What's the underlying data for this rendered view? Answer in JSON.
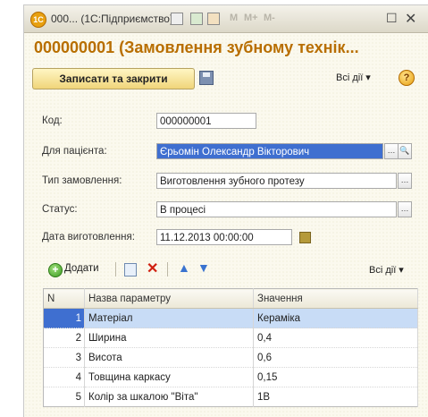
{
  "window": {
    "title": "000... (1С:Підприємство)",
    "toolbar_ghost_labels": [
      "M",
      "M+",
      "M-"
    ]
  },
  "document": {
    "title": "000000001 (Замовлення зубному технік..."
  },
  "command_bar": {
    "save_close_label": "Записати та закрити",
    "all_actions_label": "Всі дії ▾",
    "help_label": "?"
  },
  "form": {
    "code": {
      "label": "Код:",
      "value": "000000001"
    },
    "patient": {
      "label": "Для пацієнта:",
      "value": "Єрьомін Олександр Вікторович"
    },
    "order_type": {
      "label": "Тип замовлення:",
      "value": "Виготовлення зубного протезу"
    },
    "status": {
      "label": "Статус:",
      "value": "В процесі"
    },
    "date": {
      "label": "Дата виготовлення:",
      "value": "11.12.2013 00:00:00"
    }
  },
  "table_toolbar": {
    "add_label": "Додати",
    "all_actions_label": "Всі дії ▾"
  },
  "table": {
    "columns": [
      "N",
      "Назва параметру",
      "Значення"
    ],
    "rows": [
      {
        "n": "1",
        "name": "Матеріал",
        "value": "Кераміка"
      },
      {
        "n": "2",
        "name": "Ширина",
        "value": "0,4"
      },
      {
        "n": "3",
        "name": "Висота",
        "value": "0,6"
      },
      {
        "n": "4",
        "name": "Товщина каркасу",
        "value": "0,15"
      },
      {
        "n": "5",
        "name": "Колір за шкалою \"Віта\"",
        "value": "1В"
      }
    ],
    "selected_row": 0
  }
}
